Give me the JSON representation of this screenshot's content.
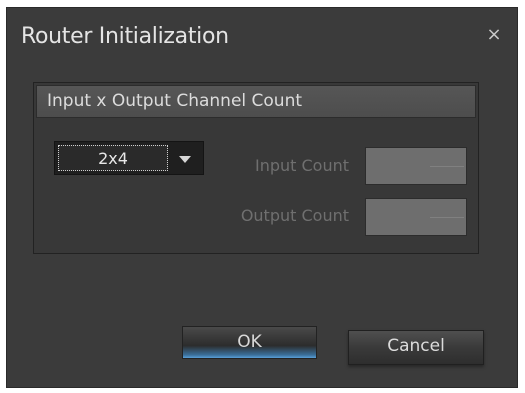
{
  "window": {
    "title": "Router Initialization",
    "close_icon": "close-icon",
    "close_glyph": "×"
  },
  "group": {
    "title": "Input x Output Channel Count"
  },
  "channel_select": {
    "value": "2x4",
    "icon": "chevron-down-icon"
  },
  "fields": {
    "input_label": "Input Count",
    "input_value": "",
    "output_label": "Output Count",
    "output_value": ""
  },
  "buttons": {
    "ok_label": "OK",
    "cancel_label": "Cancel"
  },
  "colors": {
    "dialog_bg": "#3b3b3b",
    "accent_blue": "#5aa0d8",
    "disabled_text": "#6f6f6f"
  }
}
